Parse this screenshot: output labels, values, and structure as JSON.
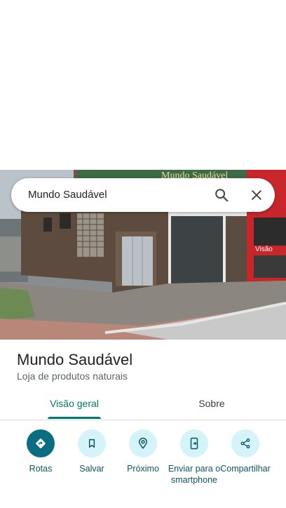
{
  "search": {
    "query": "Mundo Saudável"
  },
  "photo": {
    "sign_text": "Mundo Saudável",
    "shop_sign_right": "Visão",
    "shop_sign_right2": "Visão"
  },
  "place": {
    "name": "Mundo Saudável",
    "category": "Loja de produtos naturais"
  },
  "tabs": [
    {
      "label": "Visão geral",
      "selected": true
    },
    {
      "label": "Sobre",
      "selected": false
    }
  ],
  "actions": [
    {
      "label": "Rotas",
      "icon": "directions-icon"
    },
    {
      "label": "Salvar",
      "icon": "bookmark-icon"
    },
    {
      "label": "Próximo",
      "icon": "nearby-icon"
    },
    {
      "label": "Enviar para o smartphone",
      "icon": "send-to-phone-icon"
    },
    {
      "label": "Compartilhar",
      "icon": "share-icon"
    }
  ],
  "colors": {
    "accent": "#00796b",
    "action_bg": "#d4f4fa",
    "primary_action": "#0c6d80"
  }
}
